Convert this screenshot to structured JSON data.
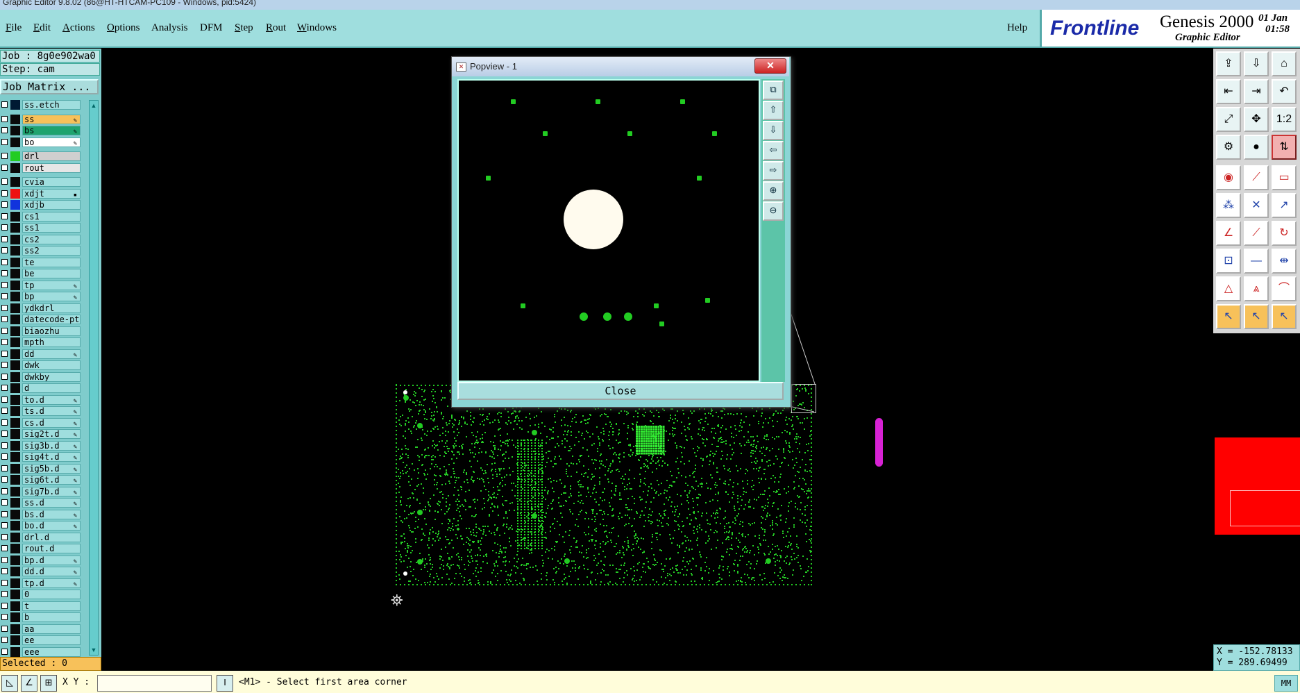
{
  "window": {
    "title": "Graphic Editor 9.8.02 (86@HT-HTCAM-PC109 - Windows, pid:5424)"
  },
  "menubar": {
    "items": [
      {
        "label": "File",
        "u": "F",
        "rest": "ile"
      },
      {
        "label": "Edit",
        "u": "E",
        "rest": "dit"
      },
      {
        "label": "Actions",
        "u": "A",
        "rest": "ctions"
      },
      {
        "label": "Options",
        "u": "O",
        "rest": "ptions"
      },
      {
        "label": "Analysis",
        "u": "",
        "rest": "Analysis"
      },
      {
        "label": "DFM",
        "u": "",
        "rest": "DFM"
      },
      {
        "label": "Step",
        "u": "S",
        "rest": "tep"
      },
      {
        "label": "Rout",
        "u": "R",
        "rest": "out"
      },
      {
        "label": "Windows",
        "u": "W",
        "rest": "indows"
      }
    ],
    "help": "Help"
  },
  "brand": {
    "logo": "Frontline",
    "product": "Genesis 2000",
    "subtitle": "Graphic Editor",
    "date": "01 Jan",
    "time": "01:58"
  },
  "left": {
    "job": "Job : 8g0e902wa0",
    "step": "Step: cam",
    "job_matrix": "Job Matrix ...",
    "layers": [
      {
        "name": "ss.etch",
        "color": "#001a33",
        "bg": "#9fdede",
        "mark": ""
      },
      {
        "name": "ss",
        "color": "#0a0a0a",
        "bg": "#f7c15a",
        "mark": "✎"
      },
      {
        "name": "bs",
        "color": "#0a0a0a",
        "bg": "#1fa36e",
        "mark": "✎"
      },
      {
        "name": "bo",
        "color": "#0a0a0a",
        "bg": "#ffffff",
        "mark": "✎"
      },
      {
        "name": "drl",
        "color": "#22cc22",
        "bg": "#cfcfcf",
        "mark": ""
      },
      {
        "name": "rout",
        "color": "#0a0a0a",
        "bg": "#e6e6e6",
        "mark": ""
      },
      {
        "name": "cvia",
        "color": "#0a0a0a",
        "bg": "#9fdede",
        "mark": ""
      },
      {
        "name": "xdjt",
        "color": "#ee1111",
        "bg": "#9fdede",
        "mark": "▪"
      },
      {
        "name": "xdjb",
        "color": "#1133dd",
        "bg": "#9fdede",
        "mark": ""
      },
      {
        "name": "cs1",
        "color": "#0a0a0a",
        "bg": "#9fdede",
        "mark": ""
      },
      {
        "name": "ss1",
        "color": "#0a0a0a",
        "bg": "#9fdede",
        "mark": ""
      },
      {
        "name": "cs2",
        "color": "#0a0a0a",
        "bg": "#9fdede",
        "mark": ""
      },
      {
        "name": "ss2",
        "color": "#0a0a0a",
        "bg": "#9fdede",
        "mark": ""
      },
      {
        "name": "te",
        "color": "#0a0a0a",
        "bg": "#9fdede",
        "mark": ""
      },
      {
        "name": "be",
        "color": "#0a0a0a",
        "bg": "#9fdede",
        "mark": ""
      },
      {
        "name": "tp",
        "color": "#0a0a0a",
        "bg": "#9fdede",
        "mark": "✎"
      },
      {
        "name": "bp",
        "color": "#0a0a0a",
        "bg": "#9fdede",
        "mark": "✎"
      },
      {
        "name": "ydkdrl",
        "color": "#0a0a0a",
        "bg": "#9fdede",
        "mark": ""
      },
      {
        "name": "datecode-ptc",
        "color": "#0a0a0a",
        "bg": "#9fdede",
        "mark": ""
      },
      {
        "name": "biaozhu",
        "color": "#0a0a0a",
        "bg": "#9fdede",
        "mark": ""
      },
      {
        "name": "mpth",
        "color": "#0a0a0a",
        "bg": "#9fdede",
        "mark": ""
      },
      {
        "name": "dd",
        "color": "#0a0a0a",
        "bg": "#9fdede",
        "mark": "✎"
      },
      {
        "name": "dwk",
        "color": "#0a0a0a",
        "bg": "#9fdede",
        "mark": ""
      },
      {
        "name": "dwkby",
        "color": "#0a0a0a",
        "bg": "#9fdede",
        "mark": ""
      },
      {
        "name": "d",
        "color": "#0a0a0a",
        "bg": "#9fdede",
        "mark": ""
      },
      {
        "name": "to.d",
        "color": "#0a0a0a",
        "bg": "#9fdede",
        "mark": "✎"
      },
      {
        "name": "ts.d",
        "color": "#0a0a0a",
        "bg": "#9fdede",
        "mark": "✎"
      },
      {
        "name": "cs.d",
        "color": "#0a0a0a",
        "bg": "#9fdede",
        "mark": "✎"
      },
      {
        "name": "sig2t.d",
        "color": "#0a0a0a",
        "bg": "#9fdede",
        "mark": "✎"
      },
      {
        "name": "sig3b.d",
        "color": "#0a0a0a",
        "bg": "#9fdede",
        "mark": "✎"
      },
      {
        "name": "sig4t.d",
        "color": "#0a0a0a",
        "bg": "#9fdede",
        "mark": "✎"
      },
      {
        "name": "sig5b.d",
        "color": "#0a0a0a",
        "bg": "#9fdede",
        "mark": "✎"
      },
      {
        "name": "sig6t.d",
        "color": "#0a0a0a",
        "bg": "#9fdede",
        "mark": "✎"
      },
      {
        "name": "sig7b.d",
        "color": "#0a0a0a",
        "bg": "#9fdede",
        "mark": "✎"
      },
      {
        "name": "ss.d",
        "color": "#0a0a0a",
        "bg": "#9fdede",
        "mark": "✎"
      },
      {
        "name": "bs.d",
        "color": "#0a0a0a",
        "bg": "#9fdede",
        "mark": "✎"
      },
      {
        "name": "bo.d",
        "color": "#0a0a0a",
        "bg": "#9fdede",
        "mark": "✎"
      },
      {
        "name": "drl.d",
        "color": "#0a0a0a",
        "bg": "#9fdede",
        "mark": ""
      },
      {
        "name": "rout.d",
        "color": "#0a0a0a",
        "bg": "#9fdede",
        "mark": ""
      },
      {
        "name": "bp.d",
        "color": "#0a0a0a",
        "bg": "#9fdede",
        "mark": "✎"
      },
      {
        "name": "dd.d",
        "color": "#0a0a0a",
        "bg": "#9fdede",
        "mark": "✎"
      },
      {
        "name": "tp.d",
        "color": "#0a0a0a",
        "bg": "#9fdede",
        "mark": "✎"
      },
      {
        "name": "0",
        "color": "#0a0a0a",
        "bg": "#9fdede",
        "mark": ""
      },
      {
        "name": "t",
        "color": "#0a0a0a",
        "bg": "#9fdede",
        "mark": ""
      },
      {
        "name": "b",
        "color": "#0a0a0a",
        "bg": "#9fdede",
        "mark": ""
      },
      {
        "name": "aa",
        "color": "#0a0a0a",
        "bg": "#9fdede",
        "mark": ""
      },
      {
        "name": "ee",
        "color": "#0a0a0a",
        "bg": "#9fdede",
        "mark": ""
      },
      {
        "name": "eee",
        "color": "#0a0a0a",
        "bg": "#9fdede",
        "mark": ""
      }
    ],
    "selected": "Selected : 0"
  },
  "popview": {
    "title": "Popview - 1",
    "close_label": "Close",
    "tool_icons": [
      "zoom-fit-icon",
      "pan-up-icon",
      "pan-down-icon",
      "pan-left-icon",
      "pan-right-icon",
      "zoom-in-icon",
      "zoom-out-icon"
    ]
  },
  "right": {
    "tools": [
      [
        "layer-up-icon",
        "layer-down-icon",
        "home-icon"
      ],
      [
        "pan-left-icon",
        "pan-right-icon",
        "undo-view-icon"
      ],
      [
        "zoom-fit-icon",
        "zoom-area-icon",
        "scale-1to2-icon"
      ],
      [
        "measure-icon",
        "snap-icon",
        "route-icon"
      ],
      [
        "add-pad-icon",
        "add-line-icon",
        "ruler-icon"
      ],
      [
        "connect-icon",
        "delete-icon",
        "move-icon"
      ],
      [
        "angle-icon",
        "cut-line-icon",
        "rotate-icon"
      ],
      [
        "pad-pair-icon",
        "line-split-icon",
        "stretch-icon"
      ],
      [
        "triangle-icon",
        "arc-icon",
        "arch-icon"
      ],
      [
        "select-icon",
        "select-filter-icon",
        "select-edit-icon"
      ]
    ],
    "coord_x": "X = -152.78133",
    "coord_y": "Y = 289.69499"
  },
  "status": {
    "xy_label": "X Y :",
    "xy_value": "",
    "prompt": "<M1> - Select first area corner",
    "units": "MM"
  }
}
